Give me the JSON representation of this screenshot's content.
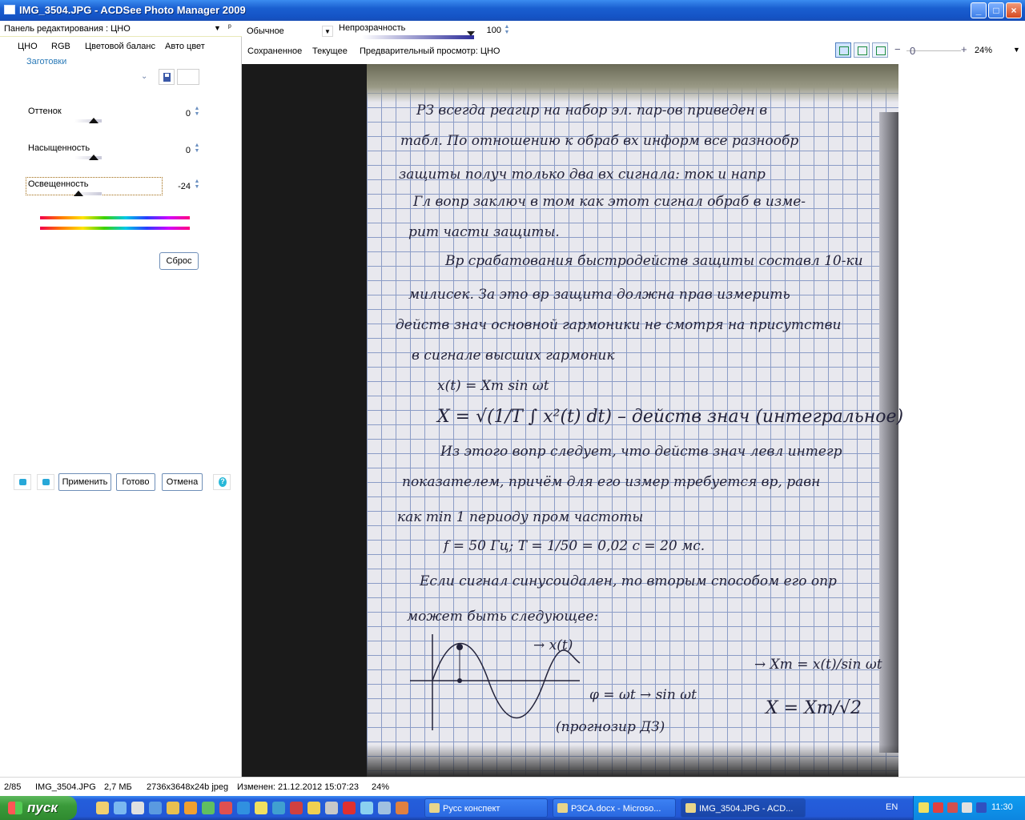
{
  "window": {
    "title": "IMG_3504.JPG - ACDSee Photo Manager 2009",
    "min": "_",
    "max": "□",
    "close": "×"
  },
  "edit_panel": {
    "header": "Панель редактирования : ЦНО",
    "tabs": [
      "ЦНО",
      "RGB",
      "Цветовой баланс",
      "Авто цвет"
    ],
    "presets": "Заготовки",
    "sliders": [
      {
        "label": "Оттенок",
        "value": "0"
      },
      {
        "label": "Насыщенность",
        "value": "0"
      },
      {
        "label": "Освещенность",
        "value": "-24"
      }
    ],
    "slider_levels": [
      0.5,
      0.5,
      0.38
    ],
    "reset": "Сброс",
    "apply": "Применить",
    "done": "Готово",
    "cancel": "Отмена"
  },
  "toolbar": {
    "mode": "Обычное",
    "opacity_label": "Непрозрачность",
    "opacity_value": "100",
    "view_saved": "Сохраненное",
    "view_current": "Текущее",
    "view_preview": "Предварительный просмотр: ЦНО",
    "zoom_minus": "−",
    "zoom_value_label": "0",
    "zoom_plus": "+",
    "zoom": "24%"
  },
  "document": {
    "lines": [
      "РЗ всегда реагир на набор эл. пар-ов приведен в",
      "табл. По отношению к обраб вх информ все разнообр",
      "защиты получ только два вх сигнала: ток и напр",
      "Гл вопр заключ в том как этот сигнал обраб в изме-",
      "рит части защиты.",
      "Вр срабатования быстродейств защиты составл 10-ки",
      "милисек. За это вр защита должна прав измерить",
      "действ знач основной гармоники не смотря на присутстви",
      "в сигнале высших гармоник",
      "x(t) = Xm sin ωt",
      "X = √(1/T ∫ x²(t) dt) – действ знач (интегральное)",
      "Из этого вопр следует, что действ знач левл интегр",
      "показателем, причём для его измер требуется вр, равн",
      "как min 1 периоду пром частоты",
      "f = 50 Гц;     T = 1/50 = 0,02 с = 20 мс.",
      "Если сигнал синусоидален, то вторым способом его опр",
      "может быть следующее:",
      "→ x(t)",
      "φ = ωt → sin ωt",
      "→ Xm = x(t)/sin ωt",
      "X = Xm/√2",
      "(прогнозир ДЗ)"
    ]
  },
  "status": {
    "index": "2/85",
    "filename": "IMG_3504.JPG",
    "size": "2,7 МБ",
    "dims": "2736x3648x24b jpeg",
    "modified": "Изменен: 21.12.2012 15:07:23",
    "zoom": "24%"
  },
  "taskbar": {
    "start": "пуск",
    "tasks": [
      "Русс конспект",
      "РЗСА.docx - Microso...",
      "IMG_3504.JPG - ACD..."
    ],
    "lang": "EN",
    "clock": "11:30"
  },
  "colors": {
    "title_bar": "#1452c4",
    "link_blue": "#2a7ab8",
    "taskbar": "#245edb",
    "start_green": "#3a9a3a"
  },
  "icons": [
    "app-icon",
    "save-preset-icon",
    "chevron-down-icon",
    "help-icon",
    "view-mode-icon",
    "windows-flag-icon"
  ]
}
